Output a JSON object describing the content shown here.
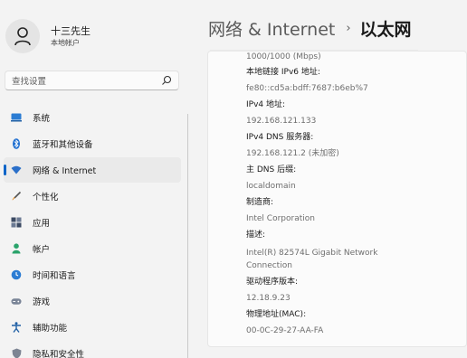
{
  "user": {
    "name": "十三先生",
    "account_type": "本地帐户"
  },
  "search": {
    "placeholder": "查找设置"
  },
  "sidebar": {
    "items": [
      {
        "label": "系统",
        "icon": "monitor-icon"
      },
      {
        "label": "蓝牙和其他设备",
        "icon": "bluetooth-icon"
      },
      {
        "label": "网络 & Internet",
        "icon": "wifi-icon",
        "active": true
      },
      {
        "label": "个性化",
        "icon": "brush-icon"
      },
      {
        "label": "应用",
        "icon": "apps-icon"
      },
      {
        "label": "帐户",
        "icon": "person-icon"
      },
      {
        "label": "时间和语言",
        "icon": "globe-clock-icon"
      },
      {
        "label": "游戏",
        "icon": "gamepad-icon"
      },
      {
        "label": "辅助功能",
        "icon": "accessibility-icon"
      },
      {
        "label": "隐私和安全性",
        "icon": "shield-icon"
      }
    ]
  },
  "header": {
    "parent": "网络 & Internet",
    "separator": "›",
    "current": "以太网"
  },
  "properties": [
    {
      "value": "1000/1000 (Mbps)"
    },
    {
      "label": "本地链接 IPv6 地址:",
      "value": "fe80::cd5a:bdff:7687:b6eb%7"
    },
    {
      "label": "IPv4 地址:",
      "value": "192.168.121.133"
    },
    {
      "label": "IPv4 DNS 服务器:",
      "value": "192.168.121.2 (未加密)"
    },
    {
      "label": "主 DNS 后缀:",
      "value": "localdomain"
    },
    {
      "label": "制造商:",
      "value": "Intel Corporation"
    },
    {
      "label": "描述:",
      "value": "Intel(R) 82574L Gigabit Network",
      "value2": "Connection"
    },
    {
      "label": "驱动程序版本:",
      "value": "12.18.9.23"
    },
    {
      "label": "物理地址(MAC):",
      "value": "00-0C-29-27-AA-FA"
    }
  ],
  "colors": {
    "accent": "#0a64c8",
    "background": "#f3f3f3",
    "card": "#fbfbfb"
  }
}
